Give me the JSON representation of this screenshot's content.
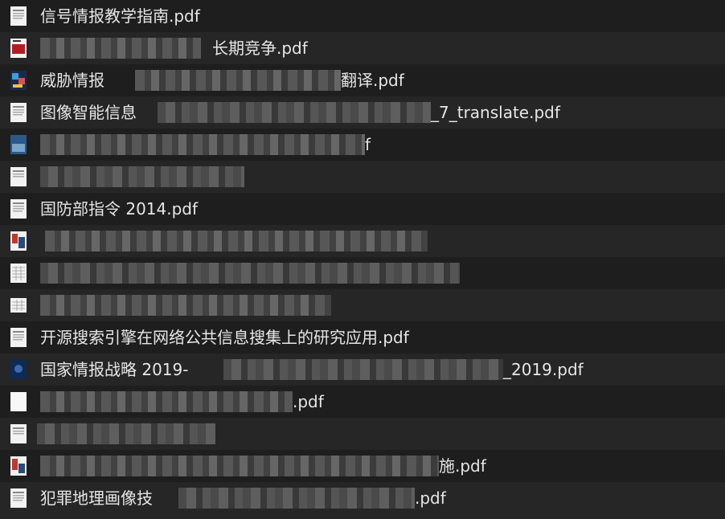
{
  "files": [
    {
      "name": "信号情报教学指南.pdf",
      "icon": "document-thumbnail-icon"
    },
    {
      "name": "长期竞争.pdf",
      "icon": "red-cover-thumbnail-icon"
    },
    {
      "name": "威胁情报",
      "suffix": "翻译.pdf",
      "icon": "colorful-cover-thumbnail-icon"
    },
    {
      "name": "图像智能信息",
      "suffix": "_7_translate.pdf",
      "icon": "document-thumbnail-icon"
    },
    {
      "name": "",
      "suffix": "f",
      "icon": "blue-cover-thumbnail-icon"
    },
    {
      "name": "",
      "icon": "document-thumbnail-icon"
    },
    {
      "name": "国防部指令 2014.pdf",
      "icon": "document-thumbnail-icon"
    },
    {
      "name": "",
      "icon": "red-blue-cover-thumbnail-icon"
    },
    {
      "name": "",
      "icon": "table-thumbnail-icon"
    },
    {
      "name": "",
      "icon": "table-thumbnail-icon"
    },
    {
      "name": "开源搜索引擎在网络公共信息搜集上的研究应用.pdf",
      "icon": "document-thumbnail-icon"
    },
    {
      "name": "国家情报战略 2019-",
      "suffix": "_2019.pdf",
      "icon": "navy-cover-thumbnail-icon"
    },
    {
      "name": "",
      "suffix": ".pdf",
      "icon": "blank-thumbnail-icon"
    },
    {
      "name": "",
      "icon": "document-thumbnail-icon"
    },
    {
      "name": "",
      "suffix": "施.pdf",
      "icon": "red-blue-cover-thumbnail-icon"
    },
    {
      "name": "犯罪地理画像技",
      "suffix": ".pdf",
      "icon": "document-thumbnail-icon"
    }
  ]
}
